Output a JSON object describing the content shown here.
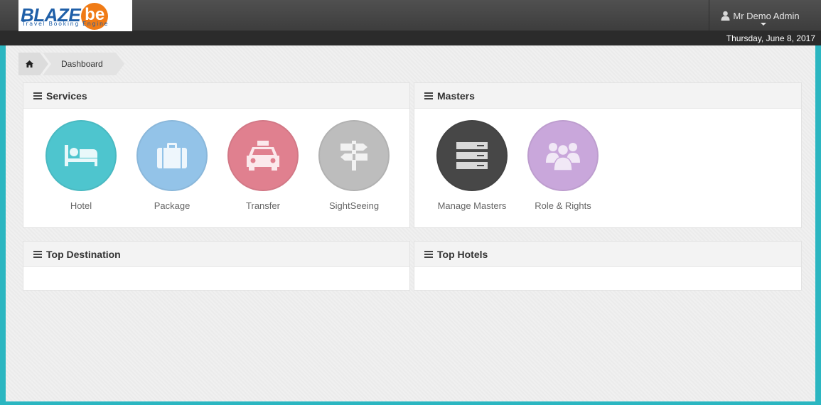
{
  "header": {
    "logo_main": "BLAZE",
    "logo_badge": "be",
    "logo_tagline": "Travel Booking Engine",
    "user_name": "Mr Demo Admin",
    "date": "Thursday, June 8, 2017"
  },
  "breadcrumb": {
    "current": "Dashboard"
  },
  "panels": {
    "services": {
      "title": "Services",
      "tiles": [
        {
          "label": "Hotel",
          "color": "#4ec5ce",
          "icon": "bed-icon"
        },
        {
          "label": "Package",
          "color": "#93c3e8",
          "icon": "suitcase-icon"
        },
        {
          "label": "Transfer",
          "color": "#e0808f",
          "icon": "taxi-icon"
        },
        {
          "label": "SightSeeing",
          "color": "#bdbdbd",
          "icon": "signpost-icon"
        }
      ]
    },
    "masters": {
      "title": "Masters",
      "tiles": [
        {
          "label": "Manage Masters",
          "color": "#474747",
          "icon": "server-icon"
        },
        {
          "label": "Role & Rights",
          "color": "#c9a7db",
          "icon": "users-icon"
        }
      ]
    },
    "top_destination": {
      "title": "Top Destination"
    },
    "top_hotels": {
      "title": "Top Hotels"
    }
  },
  "colors": {
    "frame": "#2bb6c1",
    "topbar": "#474747",
    "logo_blue": "#1f5fa8",
    "logo_orange": "#f07b16"
  }
}
